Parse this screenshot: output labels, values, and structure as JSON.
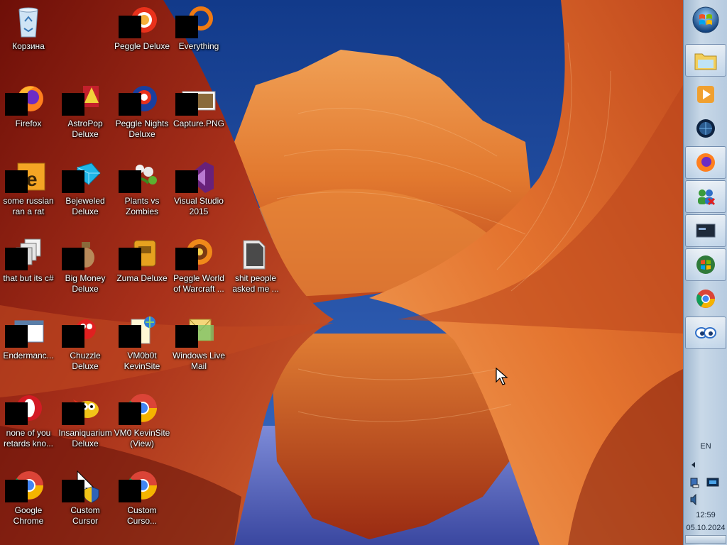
{
  "desktop": {
    "icons": [
      {
        "label": "Корзина",
        "icon": "recycle-bin-icon"
      },
      {
        "label": "Peggle Deluxe",
        "icon": "peggle-icon"
      },
      {
        "label": "Everything",
        "icon": "everything-search-icon"
      },
      {
        "label": "Firefox",
        "icon": "firefox-icon"
      },
      {
        "label": "AstroPop Deluxe",
        "icon": "astropop-icon"
      },
      {
        "label": "Peggle Nights Deluxe",
        "icon": "peggle-nights-icon"
      },
      {
        "label": "Capture.PNG",
        "icon": "image-file-icon"
      },
      {
        "label": "some russian ran a rat",
        "icon": "shortcut-icon"
      },
      {
        "label": "Bejeweled Deluxe",
        "icon": "bejeweled-icon"
      },
      {
        "label": "Plants vs Zombies",
        "icon": "plants-vs-zombies-icon"
      },
      {
        "label": "Visual Studio 2015",
        "icon": "visual-studio-icon"
      },
      {
        "label": "that but its c#",
        "icon": "folder-copy-icon"
      },
      {
        "label": "Big Money Deluxe",
        "icon": "big-money-icon"
      },
      {
        "label": "Zuma Deluxe",
        "icon": "zuma-icon"
      },
      {
        "label": "Peggle World of Warcraft ...",
        "icon": "peggle-wow-icon"
      },
      {
        "label": "shit people asked me ...",
        "icon": "folder-icon"
      },
      {
        "label": "Endermanc...",
        "icon": "window-icon"
      },
      {
        "label": "Chuzzle Deluxe",
        "icon": "chuzzle-icon"
      },
      {
        "label": "VM0b0t KevinSite",
        "icon": "web-document-icon"
      },
      {
        "label": "Windows Live Mail",
        "icon": "mail-icon"
      },
      {
        "label": "none of you retards kno...",
        "icon": "opera-icon"
      },
      {
        "label": "Insaniquarium Deluxe",
        "icon": "insaniquarium-icon"
      },
      {
        "label": "VM0 KevinSite (View)",
        "icon": "chrome-icon"
      },
      {
        "label": "Google Chrome",
        "icon": "chrome-icon"
      },
      {
        "label": "Custom Cursor",
        "icon": "cursor-shield-icon"
      },
      {
        "label": "Custom Curso...",
        "icon": "chrome-icon"
      }
    ]
  },
  "taskbar": {
    "buttons": [
      {
        "icon": "file-explorer-icon",
        "active": true
      },
      {
        "icon": "media-player-icon",
        "active": false
      },
      {
        "icon": "globe-icon",
        "active": false
      },
      {
        "icon": "firefox-icon",
        "active": true
      },
      {
        "icon": "users-icon",
        "active": true
      },
      {
        "icon": "console-icon",
        "active": true
      },
      {
        "icon": "windows-logo-icon",
        "active": true
      },
      {
        "icon": "chrome-icon",
        "active": false
      },
      {
        "icon": "eyes-icon",
        "active": true
      }
    ],
    "tray": {
      "language": "EN",
      "time": "12:59",
      "date": "05.10.2024"
    }
  },
  "colors": {
    "taskbar": "#c9d9e8",
    "label_text": "#ffffff"
  }
}
